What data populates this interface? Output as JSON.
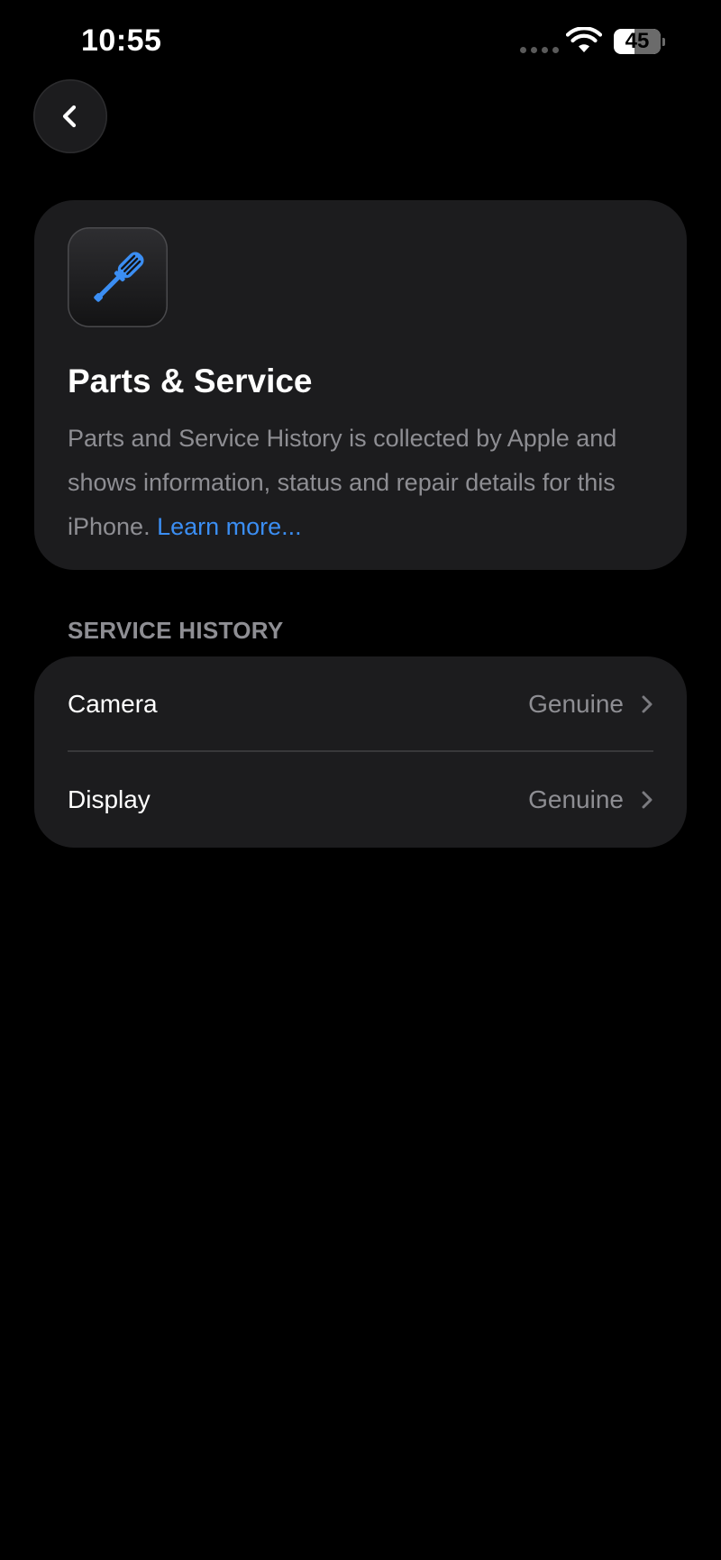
{
  "status_bar": {
    "time": "10:55",
    "battery_percent": "45",
    "battery_level": 0.45
  },
  "nav": {
    "back_icon": "chevron-left-icon"
  },
  "info_card": {
    "icon": "screwdriver-icon",
    "title": "Parts & Service",
    "description": "Parts and Service History is collected by Apple and shows information, status and repair details for this iPhone.",
    "link_text": "Learn more..."
  },
  "service_history": {
    "header": "SERVICE HISTORY",
    "items": [
      {
        "label": "Camera",
        "value": "Genuine"
      },
      {
        "label": "Display",
        "value": "Genuine"
      }
    ]
  },
  "colors": {
    "background": "#000000",
    "card": "#1c1c1e",
    "secondary_text": "#8e8e93",
    "link": "#3b8ef3",
    "icon_accent": "#3b8ef3"
  }
}
